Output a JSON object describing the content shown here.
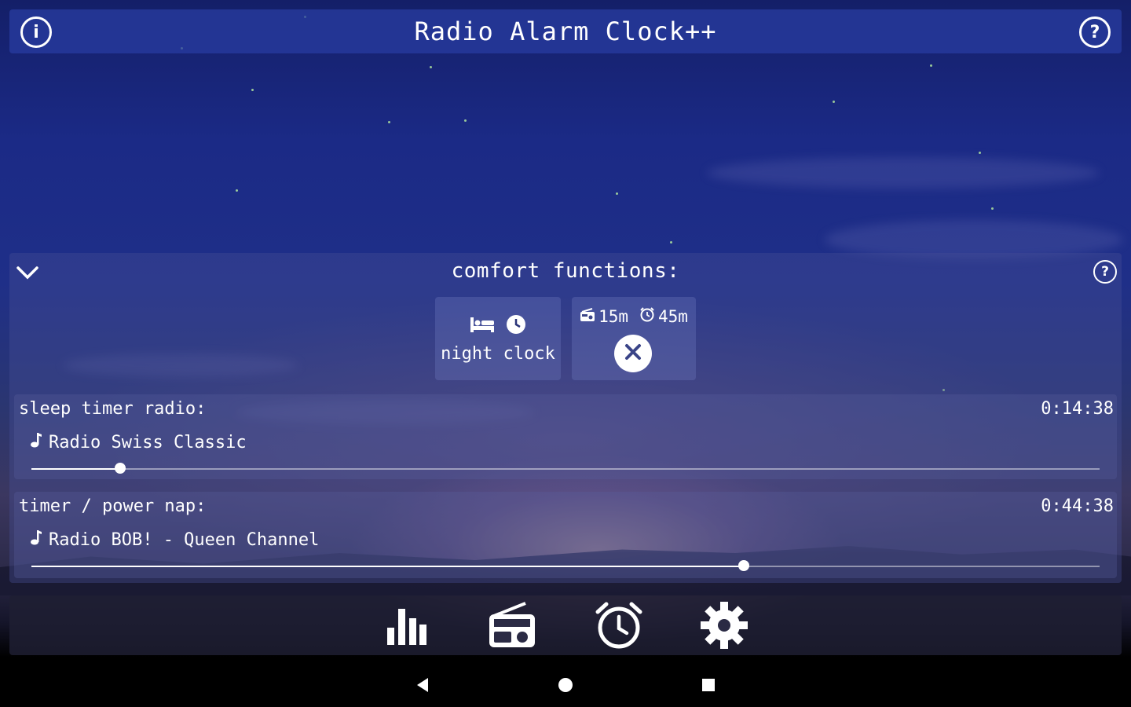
{
  "app": {
    "title": "Radio Alarm Clock++",
    "info_icon": "info-icon",
    "help_icon": "help-icon"
  },
  "comfort": {
    "title": "comfort functions:",
    "collapse_icon": "chevron-down-icon",
    "help_icon": "help-icon",
    "night_clock": {
      "icons": [
        "bed-icon",
        "clock-icon"
      ],
      "label": "night clock"
    },
    "active_timers": {
      "radio_duration": "15m",
      "alarm_duration": "45m",
      "cancel_icon": "close-icon"
    }
  },
  "sleep_timer": {
    "title": "sleep timer radio:",
    "time": "0:14:38",
    "station": "Radio Swiss Classic",
    "progress": 0.083
  },
  "power_nap": {
    "title": "timer / power nap:",
    "time": "0:44:38",
    "station": "Radio BOB! - Queen Channel",
    "progress": 0.667
  },
  "bottom_nav": [
    {
      "name": "equalizer-icon"
    },
    {
      "name": "radio-icon"
    },
    {
      "name": "alarm-clock-icon"
    },
    {
      "name": "settings-gear-icon"
    }
  ],
  "system_nav": [
    "back-icon",
    "home-icon",
    "recents-icon"
  ],
  "colors": {
    "accent": "#1f2f88",
    "text": "#ffffff"
  }
}
